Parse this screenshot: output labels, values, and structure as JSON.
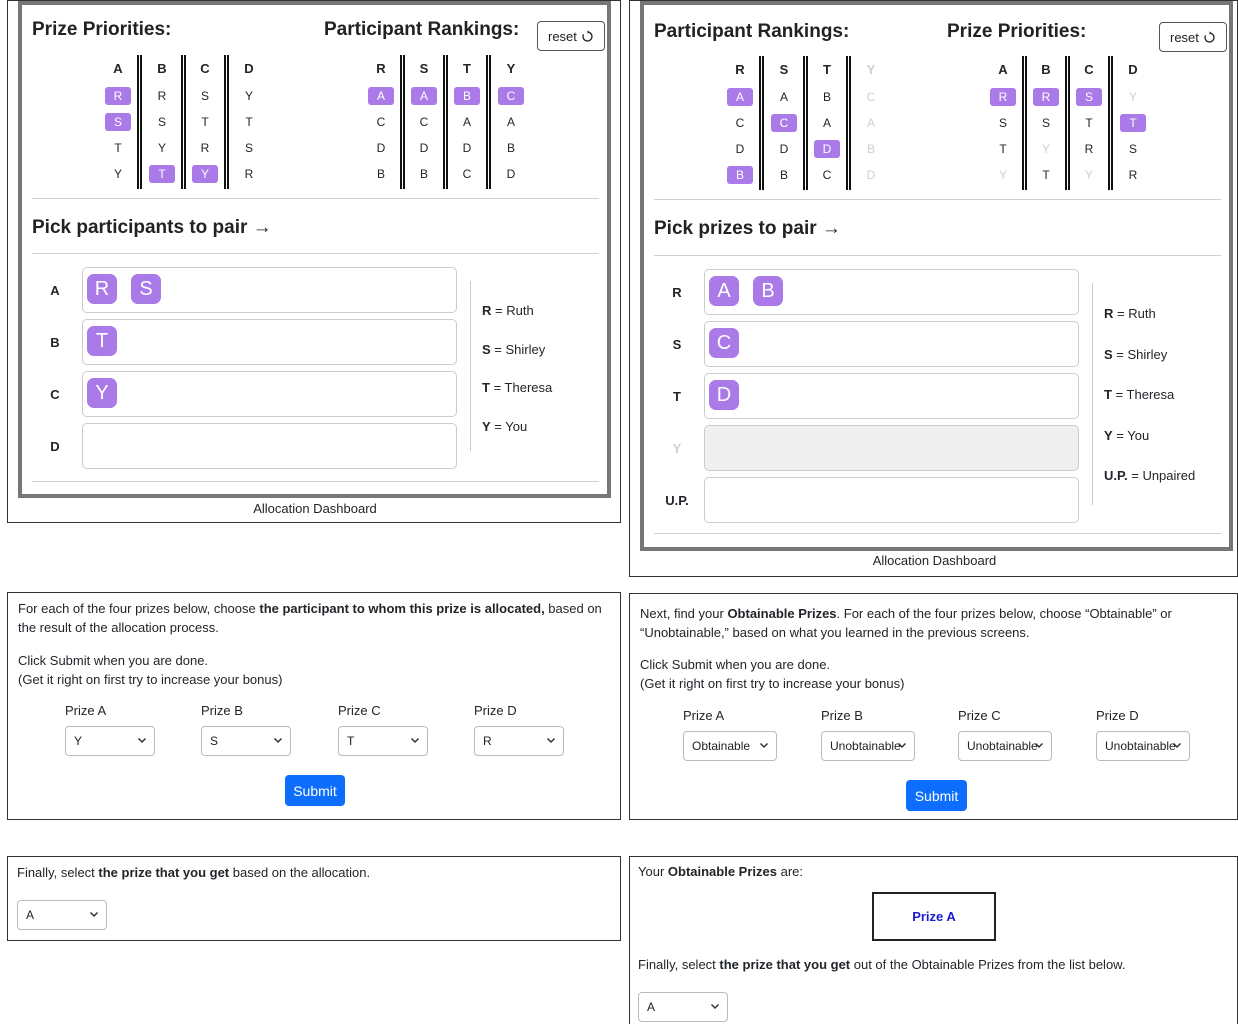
{
  "left_dashboard": {
    "title_left": "Prize Priorities:",
    "title_right": "Participant Rankings:",
    "reset_label": "reset",
    "prize_priorities": {
      "headers": [
        "A",
        "B",
        "C",
        "D"
      ],
      "cells": [
        [
          "R",
          "S",
          "T",
          "Y"
        ],
        [
          "R",
          "S",
          "Y",
          "T"
        ],
        [
          "S",
          "T",
          "R",
          "Y"
        ],
        [
          "Y",
          "T",
          "S",
          "R"
        ]
      ],
      "highlight": [
        [
          true,
          true,
          false,
          false
        ],
        [
          false,
          false,
          false,
          true
        ],
        [
          false,
          false,
          false,
          true
        ],
        [
          false,
          false,
          false,
          false
        ]
      ]
    },
    "participant_rankings": {
      "headers": [
        "R",
        "S",
        "T",
        "Y"
      ],
      "cells": [
        [
          "A",
          "C",
          "D",
          "B"
        ],
        [
          "A",
          "C",
          "D",
          "B"
        ],
        [
          "B",
          "A",
          "D",
          "C"
        ],
        [
          "C",
          "A",
          "B",
          "D"
        ]
      ],
      "highlight": [
        [
          true,
          false,
          false,
          false
        ],
        [
          true,
          false,
          false,
          false
        ],
        [
          true,
          false,
          false,
          false
        ],
        [
          true,
          false,
          false,
          false
        ]
      ]
    },
    "pick_label": "Pick participants to pair →",
    "rows": [
      {
        "label": "A",
        "chips": [
          "R",
          "S"
        ]
      },
      {
        "label": "B",
        "chips": [
          "T"
        ]
      },
      {
        "label": "C",
        "chips": [
          "Y"
        ]
      },
      {
        "label": "D",
        "chips": []
      }
    ],
    "legend": [
      {
        "key": "R",
        "value": "Ruth"
      },
      {
        "key": "S",
        "value": "Shirley"
      },
      {
        "key": "T",
        "value": "Theresa"
      },
      {
        "key": "Y",
        "value": "You"
      }
    ],
    "caption": "Allocation Dashboard"
  },
  "right_dashboard": {
    "title_left": "Participant Rankings:",
    "title_right": "Prize Priorities:",
    "reset_label": "reset",
    "participant_rankings": {
      "headers": [
        "R",
        "S",
        "T",
        "Y"
      ],
      "cells": [
        [
          "A",
          "C",
          "D",
          "B"
        ],
        [
          "A",
          "C",
          "D",
          "B"
        ],
        [
          "B",
          "A",
          "D",
          "C"
        ],
        [
          "C",
          "A",
          "B",
          "D"
        ]
      ],
      "highlight": [
        [
          true,
          false,
          false,
          true
        ],
        [
          false,
          true,
          false,
          false
        ],
        [
          false,
          false,
          true,
          false
        ],
        [
          false,
          false,
          false,
          false
        ]
      ],
      "dim_columns": [
        false,
        false,
        false,
        true
      ]
    },
    "prize_priorities": {
      "headers": [
        "A",
        "B",
        "C",
        "D"
      ],
      "cells": [
        [
          "R",
          "S",
          "T",
          "Y"
        ],
        [
          "R",
          "S",
          "Y",
          "T"
        ],
        [
          "S",
          "T",
          "R",
          "Y"
        ],
        [
          "Y",
          "T",
          "S",
          "R"
        ]
      ],
      "highlight": [
        [
          true,
          false,
          false,
          false
        ],
        [
          true,
          false,
          false,
          false
        ],
        [
          true,
          false,
          false,
          false
        ],
        [
          false,
          true,
          false,
          false
        ]
      ],
      "dim_cells": [
        [
          false,
          false,
          false,
          true
        ],
        [
          false,
          false,
          true,
          false
        ],
        [
          false,
          false,
          false,
          true
        ],
        [
          true,
          false,
          false,
          false
        ]
      ]
    },
    "pick_label": "Pick prizes to pair →",
    "rows": [
      {
        "label": "R",
        "chips": [
          "A",
          "B"
        ],
        "dim": false,
        "disabled": false
      },
      {
        "label": "S",
        "chips": [
          "C"
        ],
        "dim": false,
        "disabled": false
      },
      {
        "label": "T",
        "chips": [
          "D"
        ],
        "dim": false,
        "disabled": false
      },
      {
        "label": "Y",
        "chips": [],
        "dim": true,
        "disabled": true
      },
      {
        "label": "U.P.",
        "chips": [],
        "dim": false,
        "disabled": false
      }
    ],
    "legend": [
      {
        "key": "R",
        "value": "Ruth"
      },
      {
        "key": "S",
        "value": "Shirley"
      },
      {
        "key": "T",
        "value": "Theresa"
      },
      {
        "key": "Y",
        "value": "You"
      },
      {
        "key": "U.P.",
        "value": "Unpaired"
      }
    ],
    "caption": "Allocation Dashboard"
  },
  "left_question": {
    "para_1_pre": "For each of the four prizes below, choose ",
    "para_1_bold": "the participant to whom this prize is allocated,",
    "para_1_post": " based on the result of the allocation process.",
    "para_2": "Click Submit when you are done.",
    "para_3": "(Get it right on first try to increase your bonus)",
    "fields": [
      {
        "label": "Prize A",
        "value": "Y"
      },
      {
        "label": "Prize B",
        "value": "S"
      },
      {
        "label": "Prize C",
        "value": "T"
      },
      {
        "label": "Prize D",
        "value": "R"
      }
    ],
    "submit_label": "Submit"
  },
  "right_question": {
    "para_1_pre": "Next, find your ",
    "para_1_bold": "Obtainable Prizes",
    "para_1_post": ". For each of the four prizes below, choose “Obtainable” or “Unobtainable,” based on what you learned in the previous screens.",
    "para_2": "Click Submit when you are done.",
    "para_3": "(Get it right on first try to increase your bonus)",
    "fields": [
      {
        "label": "Prize A",
        "value": "Obtainable"
      },
      {
        "label": "Prize B",
        "value": "Unobtainable"
      },
      {
        "label": "Prize C",
        "value": "Unobtainable"
      },
      {
        "label": "Prize D",
        "value": "Unobtainable"
      }
    ],
    "submit_label": "Submit"
  },
  "left_final": {
    "text_pre": "Finally, select ",
    "text_bold": "the prize that you get",
    "text_post": " based on the allocation.",
    "select_value": "A"
  },
  "right_final": {
    "intro_pre": "Your ",
    "intro_bold": "Obtainable Prizes",
    "intro_post": " are:",
    "obtainable_prize": "Prize A",
    "text_pre": "Finally, select ",
    "text_bold": "the prize that you get",
    "text_post": " out of the Obtainable Prizes from the list below.",
    "select_value": "A"
  },
  "colors": {
    "chip": "#a97ae8",
    "submit": "#0d6efd",
    "obtainable_text": "#1b1bd4",
    "dim": "#cfcfcf"
  }
}
